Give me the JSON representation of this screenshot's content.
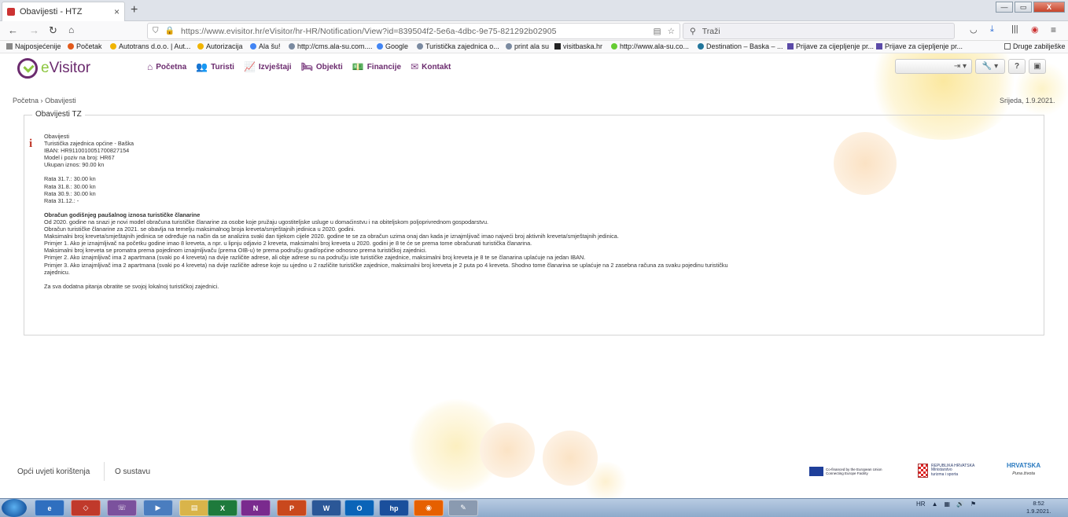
{
  "browser": {
    "tab_title": "Obavijesti - HTZ",
    "tab_close": "×",
    "new_tab": "+",
    "url": "https://www.evisitor.hr/eVisitor/hr-HR/Notification/View?id=839504f2-5e6a-4dbc-9e75-821292b02905",
    "search_placeholder": "Traži",
    "win_minimize": "—",
    "win_maximize": "▭",
    "win_close": "X"
  },
  "bookmarks": [
    "Najposjećenije",
    "Početak",
    "Autotrans d.o.o. | Aut...",
    "Autorizacija",
    "Ala šu!",
    "http://cms.ala-su.com....",
    "Google",
    "Turistička zajednica o...",
    "print ala su",
    "visitbaska.hr",
    "http://www.ala-su.co...",
    "Destination – Baska – ...",
    "Prijave za cijepljenje pr...",
    "Prijave za cijepljenje pr...",
    "Druge zabilješke"
  ],
  "app": {
    "logo_e": "e",
    "logo_name": "Visitor",
    "menu": [
      "Početna",
      "Turisti",
      "Izvještaji",
      "Objekti",
      "Financije",
      "Kontakt"
    ],
    "help_label": "?"
  },
  "breadcrumb": {
    "home": "Početna",
    "sep": "›",
    "current": "Obavijesti"
  },
  "date": "Srijeda, 1.9.2021.",
  "panel": {
    "legend": "Obavijesti TZ",
    "info_icon": "i",
    "lines": [
      "Obavijesti",
      "Turistička zajednica općine - Baška",
      "IBAN: HR9110010051700827154",
      "Model i poziv na broj: HR67",
      "Ukupan iznos: 90.00 kn",
      "",
      "Rata 31.7.: 30.00 kn",
      "Rata 31.8.: 30.00 kn",
      "Rata 30.9.: 30.00 kn",
      "Rata 31.12.: -",
      ""
    ],
    "heading": "Obračun godišnjeg paušalnog iznosa turističke članarine",
    "body": [
      "Od 2020. godine na snazi je novi model obračuna turističke članarine za osobe koje pružaju ugostiteljske usluge u domaćinstvu i na obiteljskom poljoprivrednom gospodarstvu.",
      "Obračun turističke članarine za 2021. se obavlja na temelju maksimalnog broja kreveta/smještajnih jedinica u 2020. godini.",
      "Maksimalni broj kreveta/smještajnih jedinica se određuje na način da se analizira svaki dan tijekom cijele 2020. godine te se za obračun uzima onaj dan kada je iznajmljivač imao najveći broj aktivnih kreveta/smještajnih jedinica.",
      "Primjer 1. Ako je iznajmljivač na početku godine imao 8 kreveta, a npr. u lipnju odjavio 2 kreveta, maksimalni broj kreveta u 2020. godini je 8 te će se prema tome obračunati turistička članarina.",
      "Maksimalni broj kreveta se promatra prema pojedinom iznajmljivaču (prema OIB-u) te prema području grad/općine odnosno prema turističkoj zajednici.",
      "Primjer 2. Ako iznajmljivač ima 2 apartmana (svaki po 4 kreveta) na dvije različite adrese, ali obje adrese su na području iste turističke zajednice, maksimalni broj kreveta je 8 te se članarina uplaćuje na jedan IBAN.",
      "Primjer 3. Ako iznajmljivač ima 2 apartmana (svaki po 4 kreveta) na dvije različite adrese koje su ujedno u 2 različite turističke zajednice, maksimalni broj kreveta je 2 puta po 4 kreveta. Shodno tome članarina se uplaćuje na 2 zasebna računa za svaku pojedinu turističku",
      "zajednicu.",
      "",
      "Za sva dodatna pitanja obratite se svojoj lokalnoj turističkoj zajednici."
    ]
  },
  "footer": {
    "terms": "Opći uvjeti korištenja",
    "about": "O sustavu",
    "eu_line1": "Co-financed by the European Union",
    "eu_line2": "Connecting Europe Facility",
    "ministry_line1": "REPUBLIKA HRVATSKA",
    "ministry_line2": "Ministarstvo",
    "ministry_line3": "turizma i sporta",
    "hr_brand": "HRVATSKA",
    "hr_slogan": "Puna života"
  },
  "taskbar": {
    "apps": [
      "Internet Explorer",
      "Foxit",
      "Viber",
      "Media",
      "Explorer",
      "Excel",
      "OneNote",
      "PowerPoint",
      "Word",
      "Outlook",
      "HP",
      "Firefox",
      "Paint"
    ],
    "app_glyphs": [
      "e",
      "◇",
      "☏",
      "▶",
      "▤",
      "X",
      "N",
      "P",
      "W",
      "O",
      "hp",
      "◉",
      "✎"
    ],
    "tray_lang": "HR",
    "time": "8:52",
    "date": "1.9.2021."
  },
  "colors": {
    "brand_purple": "#6b2b6e",
    "brand_green": "#8cc63f",
    "info_red": "#c0392b"
  }
}
